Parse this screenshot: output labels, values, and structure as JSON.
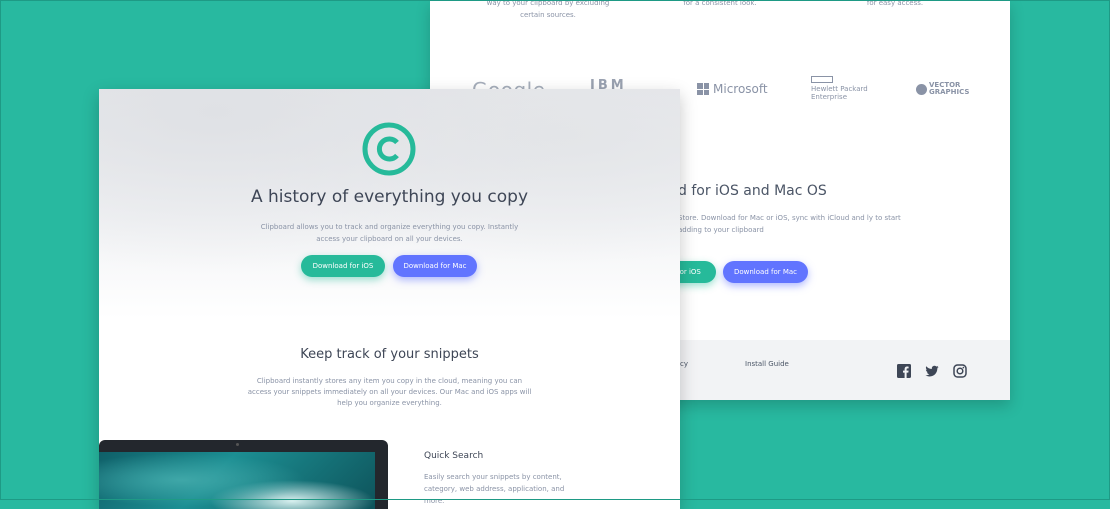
{
  "back": {
    "features": [
      "way to your clipboard by excluding certain sources.",
      "for a consistent look.",
      "for easy access."
    ],
    "logos": {
      "google": "Google",
      "ibm": "IBM",
      "microsoft": "Microsoft",
      "hp_line1": "Hewlett Packard",
      "hp_line2": "Enterprise",
      "vector_line1": "VECTOR",
      "vector_line2": "GRAPHICS"
    },
    "cta_heading": "d for iOS and Mac OS",
    "cta_text": "Store. Download for Mac or iOS, sync with iCloud and ly to start adding to your clipboard",
    "cta_ios_label": "for iOS",
    "cta_mac_label": "Download for Mac",
    "footer": {
      "link_privacy": "cy",
      "link_install": "Install Guide"
    }
  },
  "front": {
    "hero": {
      "title": "A history of everything you copy",
      "subtitle": "Clipboard allows you to track and organize everything you copy. Instantly access your clipboard on all your devices.",
      "ios_button": "Download for iOS",
      "mac_button": "Download for Mac"
    },
    "snippets": {
      "title": "Keep track of your snippets",
      "text": "Clipboard instantly stores any item you copy in the cloud, meaning you can access your snippets immediately on all your devices. Our Mac and iOS apps will help you organize everything."
    },
    "quick_search": {
      "title": "Quick Search",
      "text": "Easily search your snippets by content, category, web address, application, and more."
    }
  },
  "colors": {
    "background": "#28b9a0",
    "primary_green": "#26ba9a",
    "primary_blue": "#6174ff",
    "heading": "#3e4656",
    "body_text": "#8a93a6"
  },
  "icons": [
    "copyright-logo-icon",
    "facebook-icon",
    "twitter-icon",
    "instagram-icon"
  ]
}
